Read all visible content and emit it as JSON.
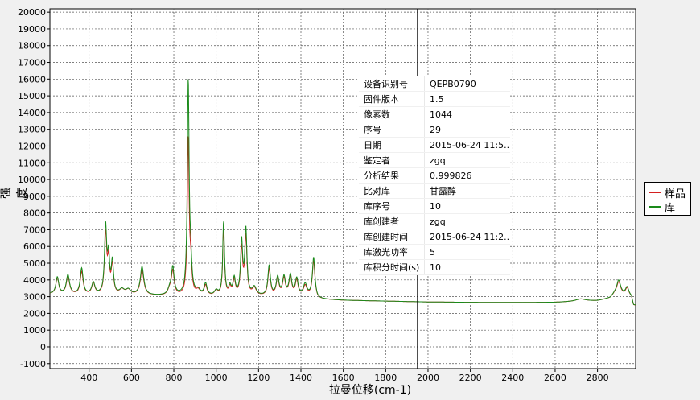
{
  "chart_data": {
    "type": "line",
    "xlabel": "拉曼位移(cm-1)",
    "ylabel": "强度",
    "xlim": [
      215,
      2980
    ],
    "ylim": [
      -1300,
      20200
    ],
    "x_ticks": [
      400,
      600,
      800,
      1000,
      1200,
      1400,
      1600,
      1800,
      2000,
      2200,
      2400,
      2600,
      2800
    ],
    "y_ticks": [
      -1000,
      0,
      1000,
      2000,
      3000,
      4000,
      5000,
      6000,
      7000,
      8000,
      9000,
      10000,
      11000,
      12000,
      13000,
      14000,
      15000,
      16000,
      17000,
      18000,
      19000,
      20000
    ],
    "grid": true,
    "legend_position": "right",
    "cursor_x": 1950,
    "baseline": [
      [
        215,
        3150
      ],
      [
        380,
        3100
      ],
      [
        700,
        3050
      ],
      [
        1000,
        3000
      ],
      [
        1250,
        3000
      ],
      [
        1460,
        3000
      ],
      [
        1480,
        2850
      ],
      [
        1600,
        2780
      ],
      [
        1800,
        2730
      ],
      [
        2000,
        2680
      ],
      [
        2200,
        2660
      ],
      [
        2400,
        2650
      ],
      [
        2600,
        2660
      ],
      [
        2700,
        2700
      ],
      [
        2800,
        2750
      ],
      [
        2860,
        2900
      ],
      [
        2880,
        3100
      ],
      [
        2960,
        2950
      ],
      [
        2970,
        2450
      ],
      [
        2980,
        2450
      ]
    ],
    "series": [
      {
        "name": "样品",
        "color": "#d42020",
        "peaks": [
          [
            250,
            950,
            8
          ],
          [
            300,
            1050,
            9
          ],
          [
            365,
            1350,
            8
          ],
          [
            420,
            650,
            9
          ],
          [
            478,
            3600,
            6
          ],
          [
            492,
            1900,
            6
          ],
          [
            510,
            1700,
            6
          ],
          [
            555,
            300,
            14
          ],
          [
            585,
            300,
            14
          ],
          [
            650,
            1500,
            10
          ],
          [
            780,
            300,
            10
          ],
          [
            795,
            1450,
            8
          ],
          [
            868,
            9300,
            5
          ],
          [
            880,
            1500,
            6
          ],
          [
            915,
            300,
            12
          ],
          [
            950,
            600,
            8
          ],
          [
            1000,
            300,
            10
          ],
          [
            1035,
            3950,
            5
          ],
          [
            1065,
            450,
            7
          ],
          [
            1085,
            900,
            7
          ],
          [
            1120,
            2800,
            6
          ],
          [
            1140,
            3500,
            6
          ],
          [
            1180,
            450,
            12
          ],
          [
            1250,
            1600,
            7
          ],
          [
            1290,
            1000,
            8
          ],
          [
            1320,
            1000,
            8
          ],
          [
            1350,
            1100,
            8
          ],
          [
            1380,
            900,
            8
          ],
          [
            1420,
            600,
            10
          ],
          [
            1460,
            2100,
            7
          ],
          [
            2720,
            150,
            30
          ],
          [
            2900,
            800,
            12
          ],
          [
            2940,
            500,
            10
          ]
        ]
      },
      {
        "name": "库",
        "color": "#1a8a1a",
        "peaks": [
          [
            250,
            1000,
            8
          ],
          [
            300,
            1150,
            9
          ],
          [
            365,
            1550,
            8
          ],
          [
            420,
            700,
            9
          ],
          [
            478,
            4000,
            6
          ],
          [
            492,
            2100,
            6
          ],
          [
            510,
            1900,
            6
          ],
          [
            555,
            300,
            14
          ],
          [
            585,
            300,
            14
          ],
          [
            650,
            1700,
            10
          ],
          [
            780,
            300,
            10
          ],
          [
            795,
            1650,
            8
          ],
          [
            868,
            12700,
            5
          ],
          [
            880,
            1700,
            6
          ],
          [
            915,
            300,
            12
          ],
          [
            950,
            700,
            8
          ],
          [
            1000,
            300,
            10
          ],
          [
            1035,
            4400,
            5
          ],
          [
            1065,
            500,
            7
          ],
          [
            1085,
            1000,
            7
          ],
          [
            1120,
            3200,
            6
          ],
          [
            1140,
            3900,
            6
          ],
          [
            1180,
            500,
            12
          ],
          [
            1250,
            1800,
            7
          ],
          [
            1290,
            1100,
            8
          ],
          [
            1320,
            1100,
            8
          ],
          [
            1350,
            1200,
            8
          ],
          [
            1380,
            1000,
            8
          ],
          [
            1420,
            700,
            10
          ],
          [
            1460,
            2300,
            7
          ],
          [
            2720,
            150,
            30
          ],
          [
            2900,
            900,
            12
          ],
          [
            2940,
            550,
            10
          ]
        ]
      }
    ]
  },
  "info_table": [
    {
      "key": "设备识别号",
      "value": "QEPB0790"
    },
    {
      "key": "固件版本",
      "value": "1.5"
    },
    {
      "key": "像素数",
      "value": "1044"
    },
    {
      "key": "序号",
      "value": "29"
    },
    {
      "key": "日期",
      "value": "2015-06-24 11:5..."
    },
    {
      "key": "鉴定者",
      "value": "zgq"
    },
    {
      "key": "分析结果",
      "value": "0.999826"
    },
    {
      "key": "比对库",
      "value": "甘露醇"
    },
    {
      "key": "库序号",
      "value": "10"
    },
    {
      "key": "库创建者",
      "value": "zgq"
    },
    {
      "key": "库创建时间",
      "value": "2015-06-24 11:2..."
    },
    {
      "key": "库激光功率",
      "value": "5"
    },
    {
      "key": "库积分时间(s)",
      "value": "10"
    }
  ]
}
